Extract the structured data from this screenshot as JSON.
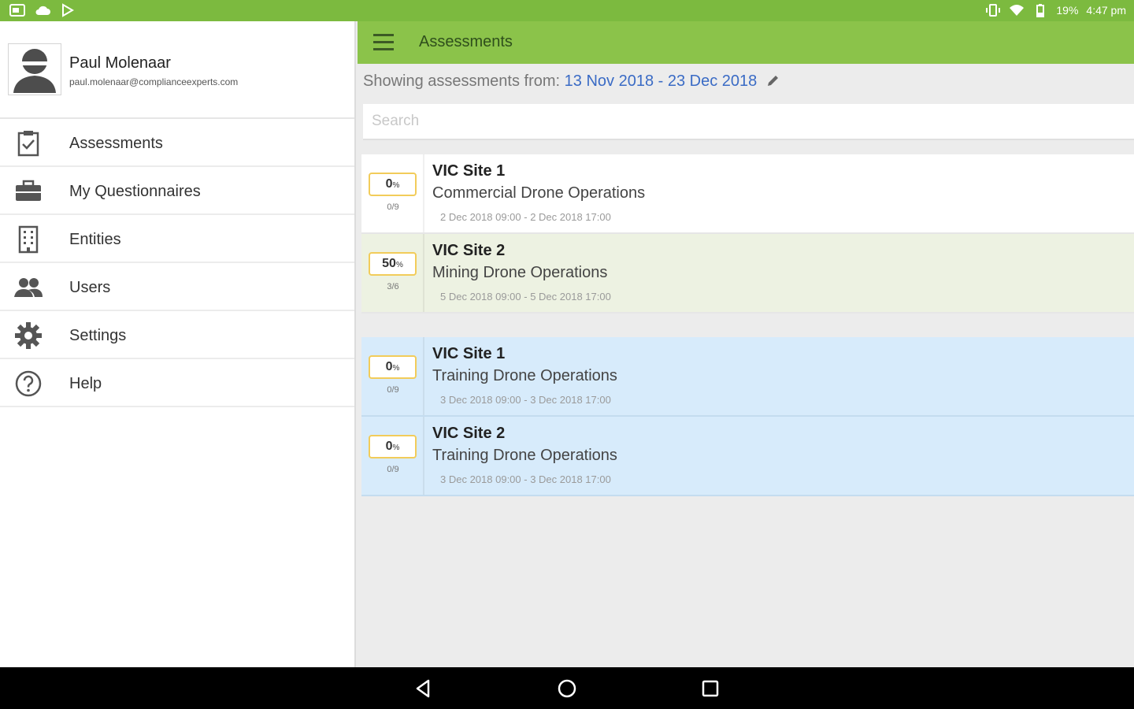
{
  "status_bar": {
    "left_icons": [
      "gallery-icon",
      "cloud-icon",
      "play-store-icon"
    ],
    "battery": "19%",
    "time": "4:47 pm"
  },
  "drawer": {
    "user_name": "Paul Molenaar",
    "user_email": "paul.molenaar@complianceexperts.com",
    "items": [
      {
        "label": "Assessments",
        "icon": "clipboard-check-icon"
      },
      {
        "label": "My Questionnaires",
        "icon": "briefcase-icon"
      },
      {
        "label": "Entities",
        "icon": "building-icon"
      },
      {
        "label": "Users",
        "icon": "users-icon"
      },
      {
        "label": "Settings",
        "icon": "gear-icon"
      },
      {
        "label": "Help",
        "icon": "help-icon"
      }
    ]
  },
  "toolbar": {
    "title": "Assessments"
  },
  "filter": {
    "prefix": "Showing assessments from:",
    "range": "13 Nov 2018 - 23 Dec 2018"
  },
  "search": {
    "placeholder": "Search",
    "value": ""
  },
  "assessments": [
    {
      "percent": "0",
      "percent_sign": "%",
      "ratio": "0/9",
      "site": "VIC Site 1",
      "operation": "Commercial Drone Operations",
      "dates": "2 Dec 2018 09:00 - 2 Dec 2018 17:00",
      "style": "white"
    },
    {
      "percent": "50",
      "percent_sign": "%",
      "ratio": "3/6",
      "site": "VIC Site 2",
      "operation": "Mining Drone Operations",
      "dates": "5 Dec 2018 09:00 - 5 Dec 2018 17:00",
      "style": "green"
    },
    {
      "percent": "0",
      "percent_sign": "%",
      "ratio": "0/9",
      "site": "VIC Site 1",
      "operation": "Training Drone Operations",
      "dates": "3 Dec 2018 09:00 - 3 Dec 2018 17:00",
      "style": "blue"
    },
    {
      "percent": "0",
      "percent_sign": "%",
      "ratio": "0/9",
      "site": "VIC Site 2",
      "operation": "Training Drone Operations",
      "dates": "3 Dec 2018 09:00 - 3 Dec 2018 17:00",
      "style": "blue"
    }
  ],
  "colors": {
    "status_bar": "#7cba3f",
    "toolbar": "#8bc34a",
    "date_range": "#3a6bc5",
    "percent_border": "#f2cc5a",
    "card_green": "#edf2e2",
    "card_blue": "#d7ebfb"
  }
}
